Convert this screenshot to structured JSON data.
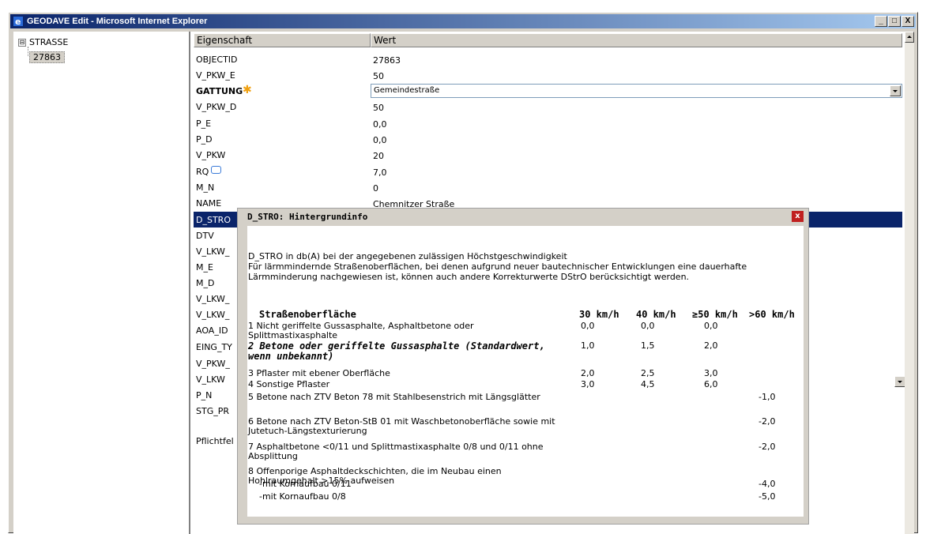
{
  "window": {
    "title": "GEODAVE Edit - Microsoft Internet Explorer",
    "min": "_",
    "max": "□",
    "close": "X",
    "icon": "ie-icon"
  },
  "tree": {
    "root": "STRASSE",
    "expander": "⊟",
    "child": "27863"
  },
  "table": {
    "col_prop": "Eigenschaft",
    "col_val": "Wert",
    "rows": [
      {
        "k": "OBJECTID",
        "v": "27863"
      },
      {
        "k": "V_PKW_E",
        "v": "50"
      },
      {
        "k": "GATTUNG",
        "v": "Gemeindestraße"
      },
      {
        "k": "V_PKW_D",
        "v": "50"
      },
      {
        "k": "P_E",
        "v": "0,0"
      },
      {
        "k": "P_D",
        "v": "0,0"
      },
      {
        "k": "V_PKW",
        "v": "20"
      },
      {
        "k": "RQ",
        "v": "7,0"
      },
      {
        "k": "M_N",
        "v": "0"
      },
      {
        "k": "NAME",
        "v": "Chemnitzer Straße"
      },
      {
        "k": "D_STRO",
        "v": ""
      },
      {
        "k": "DTV",
        "v": ""
      },
      {
        "k": "V_LKW_",
        "v": ""
      },
      {
        "k": "M_E",
        "v": ""
      },
      {
        "k": "M_D",
        "v": ""
      },
      {
        "k": "V_LKW_",
        "v": ""
      },
      {
        "k": "V_LKW_",
        "v": ""
      },
      {
        "k": "AOA_ID",
        "v": ""
      },
      {
        "k": "EING_TY",
        "v": ""
      },
      {
        "k": "V_PKW_",
        "v": ""
      },
      {
        "k": "V_LKW",
        "v": ""
      },
      {
        "k": "P_N",
        "v": ""
      },
      {
        "k": "STG_PR",
        "v": ""
      }
    ],
    "footer": "Pflichtfel",
    "required_icon": "asterisk-icon",
    "comment_icon": "speech-bubble-icon"
  },
  "popup": {
    "title": "D_STRO: Hintergrundinfo",
    "close": "x",
    "intro1": "D_STRO in db(A) bei der angegebenen zulässigen Höchstgeschwindigkeit",
    "intro2": "Für lärmmindernde Straßenoberflächen, bei denen aufgrund neuer bautechnischer Entwicklungen eine dauerhafte Lärmminderung nachgewiesen ist, können auch andere Korrekturwerte DStrO berücksichtigt werden.",
    "headers": [
      "Straßenoberfläche",
      "30 km/h",
      "40 km/h",
      "≥50 km/h",
      ">60 km/h"
    ],
    "rows": [
      {
        "d": "1 Nicht geriffelte Gussasphalte, Asphaltbetone oder Splittmastixasphalte",
        "a": "0,0",
        "b": "0,0",
        "c": "0,0",
        "e": ""
      },
      {
        "d": "2 Betone oder geriffelte Gussasphalte (Standardwert, wenn unbekannt)",
        "a": "1,0",
        "b": "1,5",
        "c": "2,0",
        "e": ""
      },
      {
        "d": "3 Pflaster mit ebener Oberfläche",
        "a": "2,0",
        "b": "2,5",
        "c": "3,0",
        "e": ""
      },
      {
        "d": "4 Sonstige Pflaster",
        "a": "3,0",
        "b": "4,5",
        "c": "6,0",
        "e": ""
      },
      {
        "d": "5 Betone nach ZTV Beton 78 mit Stahlbesenstrich mit Längsglätter",
        "a": "",
        "b": "",
        "c": "",
        "e": "-1,0"
      },
      {
        "d": "6 Betone nach ZTV Beton-StB 01 mit Waschbetonoberfläche sowie mit Jutetuch-Längstexturierung",
        "a": "",
        "b": "",
        "c": "",
        "e": "-2,0"
      },
      {
        "d": "7 Asphaltbetone <0/11 und Splittmastixasphalte 0/8 und 0/11 ohne Absplittung",
        "a": "",
        "b": "",
        "c": "",
        "e": "-2,0"
      },
      {
        "d": "8 Offenporige Asphaltdeckschichten, die im Neubau einen Hohlraumgehalt >15% aufweisen",
        "a": "",
        "b": "",
        "c": "",
        "e": ""
      },
      {
        "d": "   -mit Kornaufbau 0/11",
        "a": "",
        "b": "",
        "c": "",
        "e": "-4,0"
      },
      {
        "d": "   -mit Kornaufbau 0/8",
        "a": "",
        "b": "",
        "c": "",
        "e": "-5,0"
      }
    ]
  }
}
